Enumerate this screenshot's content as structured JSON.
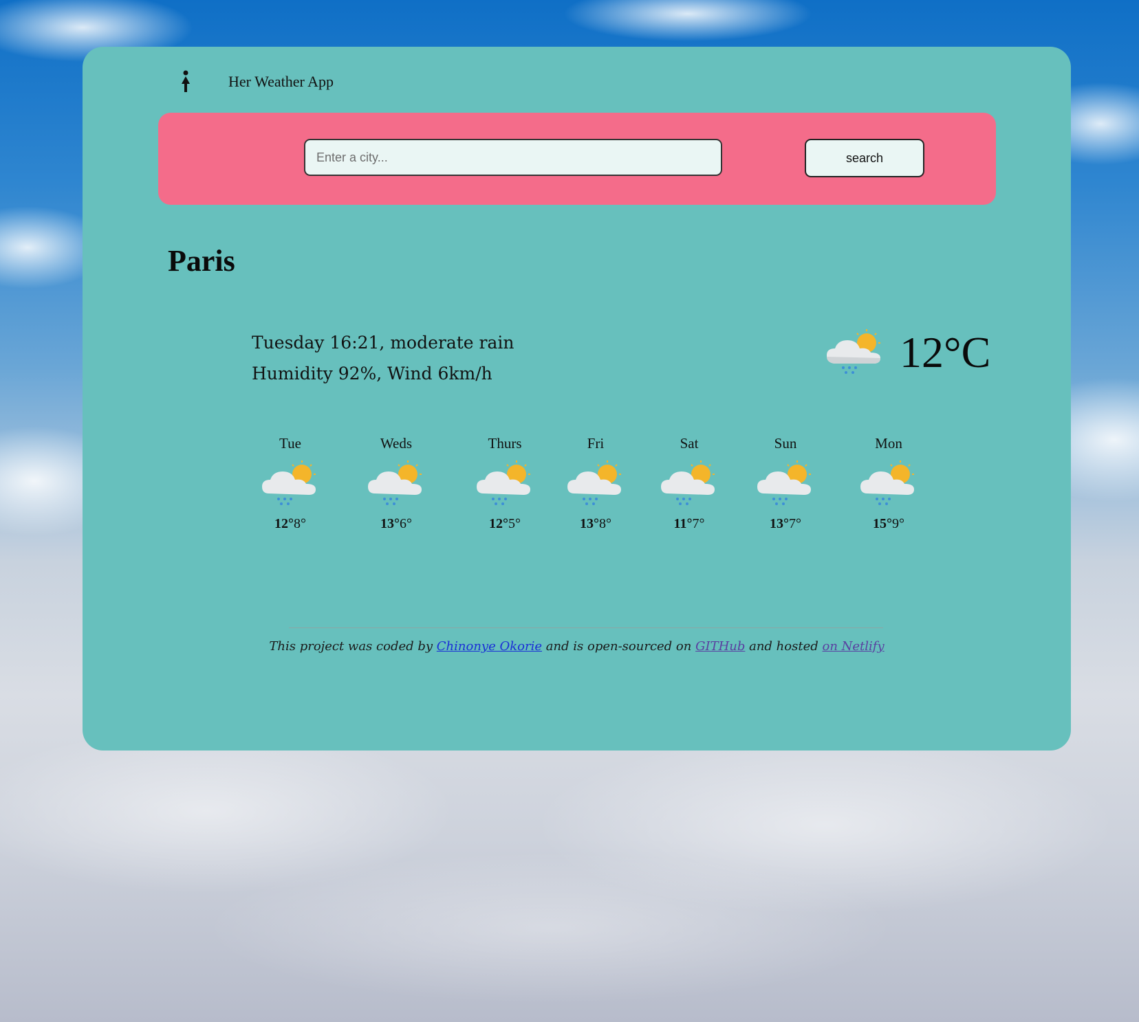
{
  "app": {
    "title": "Her Weather App"
  },
  "search": {
    "placeholder": "Enter a city...",
    "button_label": "search"
  },
  "current": {
    "city": "Paris",
    "description_line": "Tuesday 16:21, moderate rain",
    "stats_line": "Humidity 92%, Wind 6km/h",
    "temperature": "12°C",
    "icon": "rain-cloud-sun-icon"
  },
  "forecast": [
    {
      "day": "Tue",
      "high": "12°",
      "low": "8°"
    },
    {
      "day": "Weds",
      "high": "13°",
      "low": "6°"
    },
    {
      "day": "Thurs",
      "high": "12°",
      "low": "5°"
    },
    {
      "day": "Fri",
      "high": "13°",
      "low": "8°"
    },
    {
      "day": "Sat",
      "high": "11°",
      "low": "7°"
    },
    {
      "day": "Sun",
      "high": "13°",
      "low": "7°"
    },
    {
      "day": "Mon",
      "high": "15°",
      "low": "9°"
    }
  ],
  "footer": {
    "prefix": "This project was coded by ",
    "author_link": "Chinonye Okorie",
    "middle": " and is open-sourced on ",
    "github_link": "GITHub",
    "middle2": " and hosted ",
    "netlify_link": "on Netlify"
  },
  "colors": {
    "card": "#67c0bd",
    "search_panel": "#f46c8a",
    "sun": "#f4b52a",
    "rain": "#3d8fd6"
  }
}
